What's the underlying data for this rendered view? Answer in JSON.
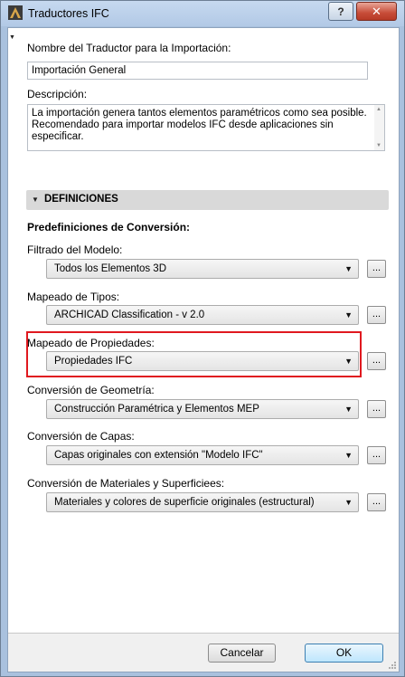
{
  "window": {
    "title": "Traductores IFC",
    "help_label": "?",
    "close_label": "✕"
  },
  "name_field": {
    "label": "Nombre del Traductor para la Importación:",
    "value": "Importación General"
  },
  "description": {
    "label": "Descripción:",
    "value": "La importación genera tantos elementos paramétricos como sea posible. Recomendado para importar modelos IFC desde aplicaciones sin especificar."
  },
  "section": {
    "title": "DEFINICIONES",
    "subtitle": "Predefiniciones de Conversión:"
  },
  "settings": [
    {
      "label": "Filtrado del Modelo:",
      "value": "Todos los Elementos 3D",
      "button": "..."
    },
    {
      "label": "Mapeado de Tipos:",
      "value": "ARCHICAD Classification - v 2.0",
      "button": "..."
    },
    {
      "label": "Mapeado de Propiedades:",
      "value": "Propiedades IFC",
      "button": "..."
    },
    {
      "label": "Conversión de Geometría:",
      "value": "Construcción Paramétrica y Elementos MEP",
      "button": "..."
    },
    {
      "label": "Conversión de Capas:",
      "value": "Capas originales con extensión \"Modelo IFC\"",
      "button": "..."
    },
    {
      "label": "Conversión de Materiales y Superficiees:",
      "value": "Materiales y colores de superficie originales (estructural)",
      "button": "..."
    }
  ],
  "footer": {
    "cancel_label": "Cancelar",
    "ok_label": "OK"
  },
  "colors": {
    "highlight": "#e0191f",
    "titlebar": "#b9cfe9",
    "close_button": "#c74c38"
  }
}
